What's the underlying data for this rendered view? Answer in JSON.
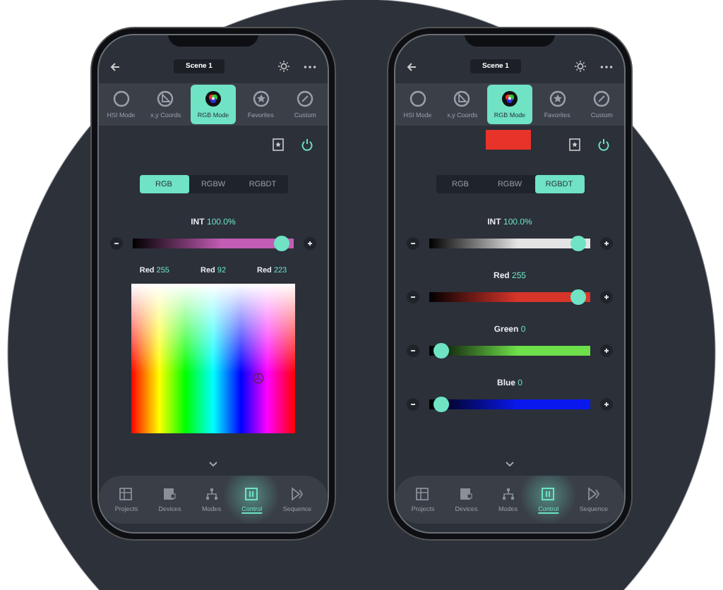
{
  "phones": [
    {
      "title": "Scene 1",
      "modes": [
        {
          "label": "HSI Mode",
          "selected": false
        },
        {
          "label": "x,y Coords",
          "selected": false
        },
        {
          "label": "RGB Mode",
          "selected": true
        },
        {
          "label": "Favorites",
          "selected": false
        },
        {
          "label": "Custom",
          "selected": false
        }
      ],
      "formats": [
        {
          "label": "RGB",
          "selected": true
        },
        {
          "label": "RGBW",
          "selected": false
        },
        {
          "label": "RGBDT",
          "selected": false
        }
      ],
      "controls": [
        {
          "kind": "slider",
          "label": "INT",
          "value": "100.0%",
          "level": 0.97,
          "color": "#c25cb4"
        },
        {
          "kind": "readouts",
          "items": [
            {
              "label": "Red",
              "value": "255"
            },
            {
              "label": "Red",
              "value": "92"
            },
            {
              "label": "Red",
              "value": "223"
            }
          ]
        },
        {
          "kind": "picker"
        }
      ],
      "nav": [
        {
          "label": "Projects",
          "selected": false
        },
        {
          "label": "Devices",
          "selected": false
        },
        {
          "label": "Modes",
          "selected": false
        },
        {
          "label": "Control",
          "selected": true
        },
        {
          "label": "Sequence",
          "selected": false
        }
      ]
    },
    {
      "title": "Scene 1",
      "swatch": {
        "color": "#e8332a"
      },
      "modes": [
        {
          "label": "HSI Mode",
          "selected": false
        },
        {
          "label": "x,y Coords",
          "selected": false
        },
        {
          "label": "RGB Mode",
          "selected": true
        },
        {
          "label": "Favorites",
          "selected": false
        },
        {
          "label": "Custom",
          "selected": false
        }
      ],
      "formats": [
        {
          "label": "RGB",
          "selected": false
        },
        {
          "label": "RGBW",
          "selected": false
        },
        {
          "label": "RGBDT",
          "selected": true
        }
      ],
      "controls": [
        {
          "kind": "slider",
          "label": "INT",
          "value": "100.0%",
          "level": 0.97,
          "color": "#e4e4e4"
        },
        {
          "kind": "slider",
          "label": "Red",
          "value": "255",
          "level": 0.97,
          "color": "#d8352a"
        },
        {
          "kind": "slider",
          "label": "Green",
          "value": "0",
          "level": 0.03,
          "color": "#6ee04a"
        },
        {
          "kind": "slider",
          "label": "Blue",
          "value": "0",
          "level": 0.03,
          "color": "#0a18ee"
        }
      ],
      "nav": [
        {
          "label": "Projects",
          "selected": false
        },
        {
          "label": "Devices",
          "selected": false
        },
        {
          "label": "Modes",
          "selected": false
        },
        {
          "label": "Control",
          "selected": true
        },
        {
          "label": "Sequence",
          "selected": false
        }
      ]
    }
  ]
}
